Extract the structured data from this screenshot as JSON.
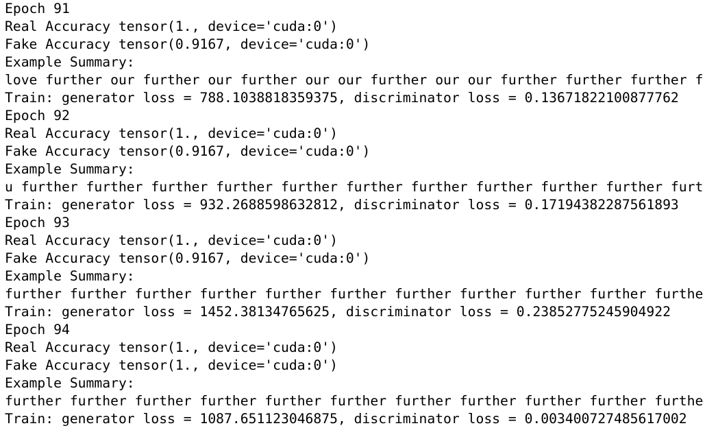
{
  "console": {
    "lines": [
      "Epoch 91",
      "Real Accuracy tensor(1., device='cuda:0')",
      "Fake Accuracy tensor(0.9167, device='cuda:0')",
      "Example Summary:",
      "love further our further our further our our further our our further further further f",
      "Train: generator loss = 788.1038818359375, discriminator loss = 0.13671822100877762",
      "Epoch 92",
      "Real Accuracy tensor(1., device='cuda:0')",
      "Fake Accuracy tensor(0.9167, device='cuda:0')",
      "Example Summary:",
      "u further further further further further further further further further further furt",
      "Train: generator loss = 932.2688598632812, discriminator loss = 0.17194382287561893",
      "Epoch 93",
      "Real Accuracy tensor(1., device='cuda:0')",
      "Fake Accuracy tensor(0.9167, device='cuda:0')",
      "Example Summary:",
      "further further further further further further further further further further furthe",
      "Train: generator loss = 1452.38134765625, discriminator loss = 0.23852775245904922",
      "Epoch 94",
      "Real Accuracy tensor(1., device='cuda:0')",
      "Fake Accuracy tensor(1., device='cuda:0')",
      "Example Summary:",
      "further further further further further further further further further further furthe",
      "Train: generator loss = 1087.651123046875, discriminator loss = 0.003400727485617002"
    ]
  }
}
